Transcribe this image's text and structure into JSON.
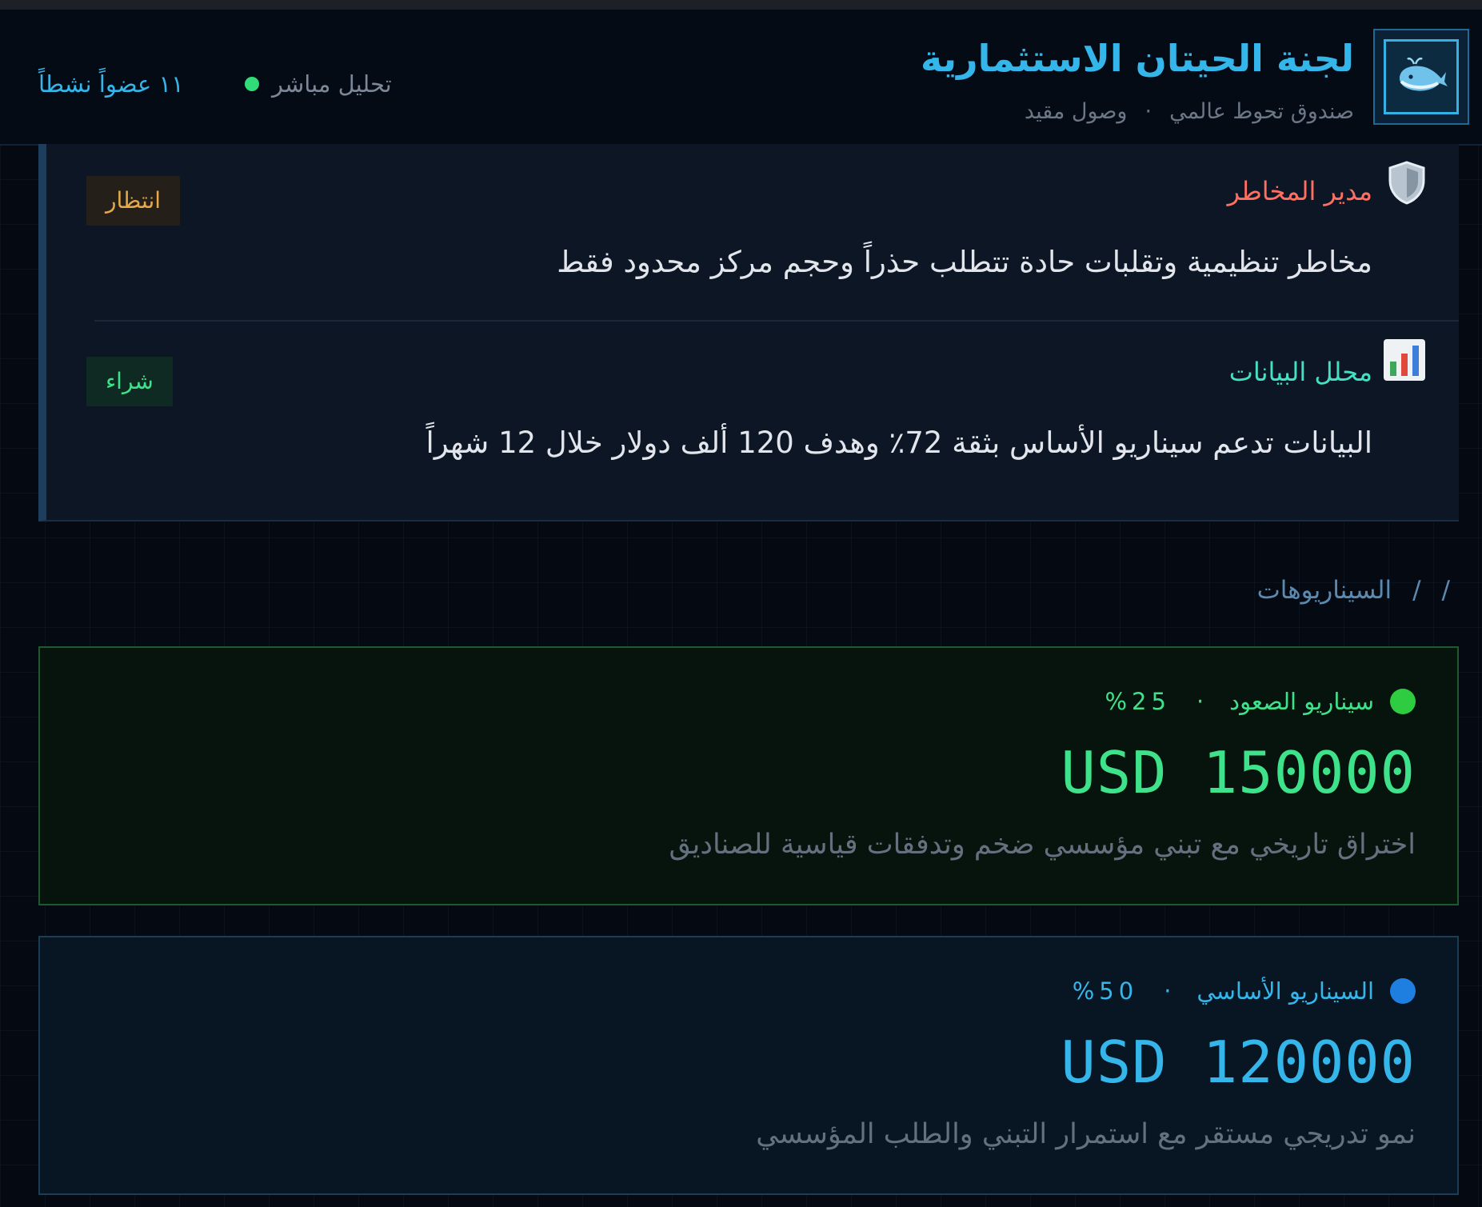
{
  "header": {
    "logo_icon": "whale-icon",
    "title": "لجنة الحيتان الاستثمارية",
    "subtitle_a": "صندوق تحوط عالمي",
    "subtitle_sep": "·",
    "subtitle_b": "وصول مقيد",
    "live_label": "تحليل مباشر",
    "members": "١١ عضواً نشطاً"
  },
  "opinions": [
    {
      "icon": "shield-icon",
      "role": "مدير المخاطر",
      "role_color": "#ff6f61",
      "text": "مخاطر تنظيمية وتقلبات حادة تتطلب حذراً وحجم مركز محدود فقط",
      "badge": "انتظار",
      "badge_color": "#e6a84a",
      "badge_bg": "#241f19"
    },
    {
      "icon": "bar-chart-icon",
      "role": "محلل البيانات",
      "role_color": "#45e0c0",
      "text": "البيانات تدعم سيناريو الأساس بثقة 72٪ وهدف 120 ألف دولار خلال 12 شهراً",
      "badge": "شراء",
      "badge_color": "#3ee28a",
      "badge_bg": "#0f2a22"
    }
  ],
  "breadcrumb": {
    "sep1": "/",
    "sep2": "/",
    "current": "السيناريوهات"
  },
  "scenarios": [
    {
      "name": "سيناريو الصعود",
      "sep": "·",
      "probability": "%25",
      "value": "USD 150000",
      "desc": "اختراق تاريخي مع تبني مؤسسي ضخم وتدفقات قياسية للصناديق",
      "color": "#3ee28a",
      "dot_color": "#2ecc40"
    },
    {
      "name": "السيناريو الأساسي",
      "sep": "·",
      "probability": "%50",
      "value": "USD 120000",
      "desc": "نمو تدريجي مستقر مع استمرار التبني والطلب المؤسسي",
      "color": "#34b6ea",
      "dot_color": "#1e7fe0"
    }
  ]
}
